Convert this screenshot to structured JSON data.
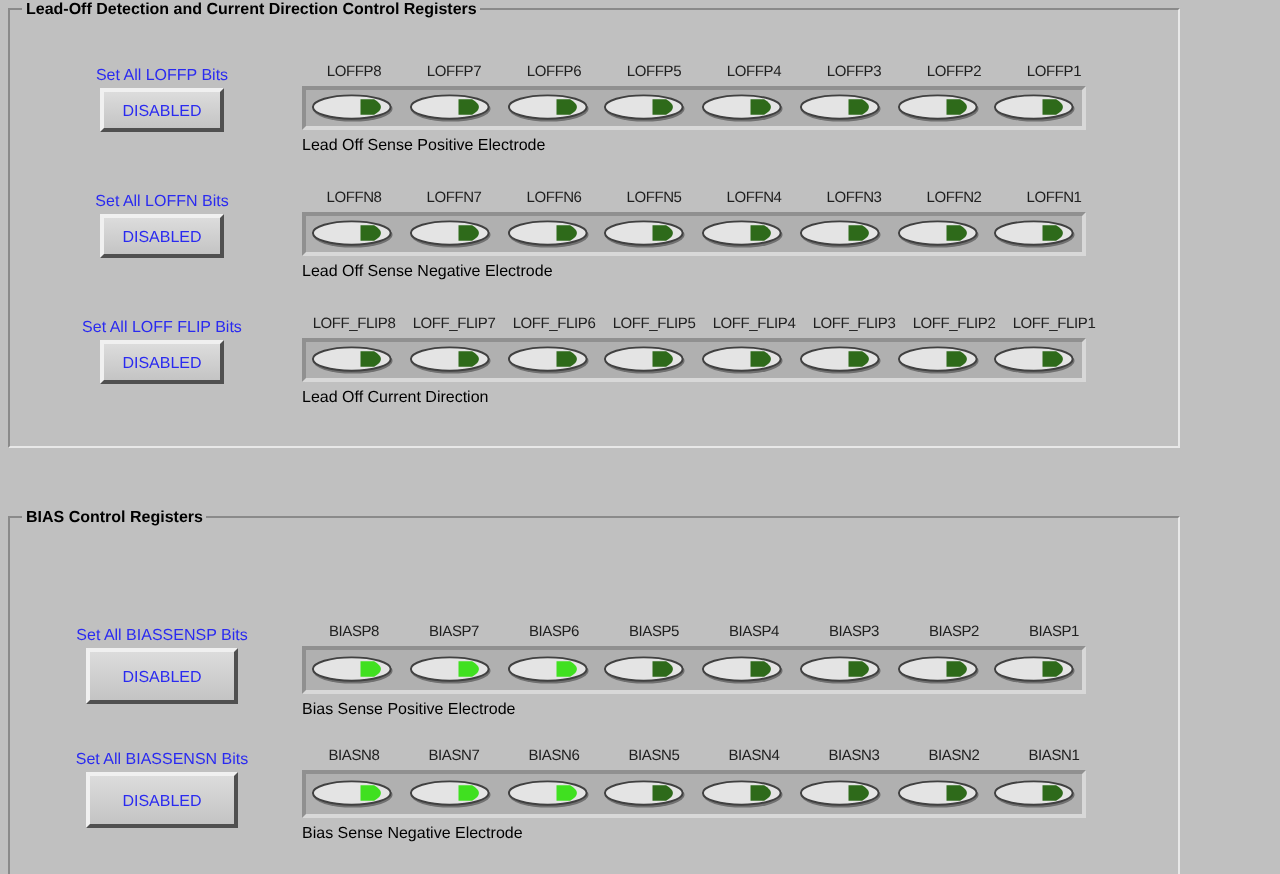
{
  "sections": [
    {
      "title": "Lead-Off Detection and Current Direction Control Registers",
      "groups": [
        {
          "set_all_label": "Set All LOFFP Bits",
          "button": "DISABLED",
          "caption": "Lead Off Sense Positive Electrode",
          "bits": [
            {
              "label": "LOFFP8",
              "on": false
            },
            {
              "label": "LOFFP7",
              "on": false
            },
            {
              "label": "LOFFP6",
              "on": false
            },
            {
              "label": "LOFFP5",
              "on": false
            },
            {
              "label": "LOFFP4",
              "on": false
            },
            {
              "label": "LOFFP3",
              "on": false
            },
            {
              "label": "LOFFP2",
              "on": false
            },
            {
              "label": "LOFFP1",
              "on": false
            }
          ]
        },
        {
          "set_all_label": "Set All LOFFN Bits",
          "button": "DISABLED",
          "caption": "Lead Off Sense Negative Electrode",
          "bits": [
            {
              "label": "LOFFN8",
              "on": false
            },
            {
              "label": "LOFFN7",
              "on": false
            },
            {
              "label": "LOFFN6",
              "on": false
            },
            {
              "label": "LOFFN5",
              "on": false
            },
            {
              "label": "LOFFN4",
              "on": false
            },
            {
              "label": "LOFFN3",
              "on": false
            },
            {
              "label": "LOFFN2",
              "on": false
            },
            {
              "label": "LOFFN1",
              "on": false
            }
          ]
        },
        {
          "set_all_label": "Set All LOFF FLIP Bits",
          "button": "DISABLED",
          "caption": "Lead Off Current Direction",
          "bits": [
            {
              "label": "LOFF_FLIP8",
              "on": false
            },
            {
              "label": "LOFF_FLIP7",
              "on": false
            },
            {
              "label": "LOFF_FLIP6",
              "on": false
            },
            {
              "label": "LOFF_FLIP5",
              "on": false
            },
            {
              "label": "LOFF_FLIP4",
              "on": false
            },
            {
              "label": "LOFF_FLIP3",
              "on": false
            },
            {
              "label": "LOFF_FLIP2",
              "on": false
            },
            {
              "label": "LOFF_FLIP1",
              "on": false
            }
          ]
        }
      ]
    },
    {
      "title": "BIAS Control Registers",
      "groups": [
        {
          "set_all_label": "Set All BIASSENSP Bits",
          "button": "DISABLED",
          "caption": "Bias Sense Positive Electrode",
          "bits": [
            {
              "label": "BIASP8",
              "on": true
            },
            {
              "label": "BIASP7",
              "on": true
            },
            {
              "label": "BIASP6",
              "on": true
            },
            {
              "label": "BIASP5",
              "on": false
            },
            {
              "label": "BIASP4",
              "on": false
            },
            {
              "label": "BIASP3",
              "on": false
            },
            {
              "label": "BIASP2",
              "on": false
            },
            {
              "label": "BIASP1",
              "on": false
            }
          ]
        },
        {
          "set_all_label": "Set All BIASSENSN Bits",
          "button": "DISABLED",
          "caption": "Bias Sense Negative Electrode",
          "bits": [
            {
              "label": "BIASN8",
              "on": true
            },
            {
              "label": "BIASN7",
              "on": true
            },
            {
              "label": "BIASN6",
              "on": true
            },
            {
              "label": "BIASN5",
              "on": false
            },
            {
              "label": "BIASN4",
              "on": false
            },
            {
              "label": "BIASN3",
              "on": false
            },
            {
              "label": "BIASN2",
              "on": false
            },
            {
              "label": "BIASN1",
              "on": false
            }
          ]
        }
      ]
    }
  ]
}
